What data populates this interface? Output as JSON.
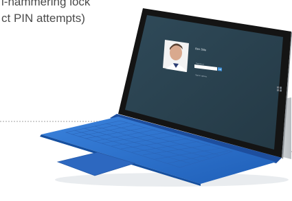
{
  "caption": {
    "line1": "i-hammering lock",
    "line2": "ct PIN attempts)"
  },
  "lock_screen": {
    "user_name": "Ben Stile",
    "password_placeholder": "Password",
    "sign_in_options": "Sign-in options"
  },
  "colors": {
    "screen": "#2c4452",
    "bezel": "#141414",
    "keyboard": "#2a6fc9",
    "trackpad": "#2d68c0",
    "kickstand": "#cfd3d6"
  }
}
